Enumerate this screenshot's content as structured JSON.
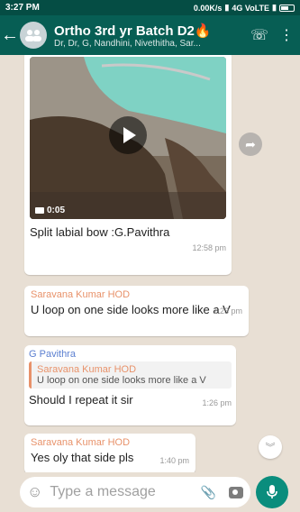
{
  "status_bar": {
    "time": "3:27 PM",
    "network_speed": "0.00K/s",
    "network_label": "4G VoLTE"
  },
  "header": {
    "group_name": "Ortho 3rd yr Batch D2",
    "members": "Dr, Dr, G, Nandhini, Nivethitha, Sar...",
    "back_icon": "back-arrow-icon",
    "call_icon": "add-call-icon",
    "menu_icon": "more-vert-icon"
  },
  "messages": [
    {
      "type": "video",
      "duration": "0:05",
      "caption": "Split labial bow :G.Pavithra",
      "time": "12:58 pm"
    },
    {
      "type": "text",
      "sender": "Saravana Kumar HOD",
      "text": "U loop on one side looks more like a V",
      "time": "1:23 pm"
    },
    {
      "type": "reply",
      "sender": "G Pavithra",
      "quoted_sender": "Saravana Kumar HOD",
      "quoted_text": "U loop on one side looks more like a V",
      "text": "Should I repeat it sir",
      "time": "1:26 pm"
    },
    {
      "type": "text",
      "sender": "Saravana Kumar HOD",
      "text": "Yes oly that side pls",
      "time": "1:40 pm"
    }
  ],
  "composer": {
    "placeholder": "Type a message"
  },
  "colors": {
    "header": "#075e54",
    "status_bar": "#054d44",
    "chat_bg": "#e8dfd4",
    "mic_button": "#0a8d7d",
    "sender_orange": "#e8926a",
    "sender_blue": "#5b7fd0"
  }
}
